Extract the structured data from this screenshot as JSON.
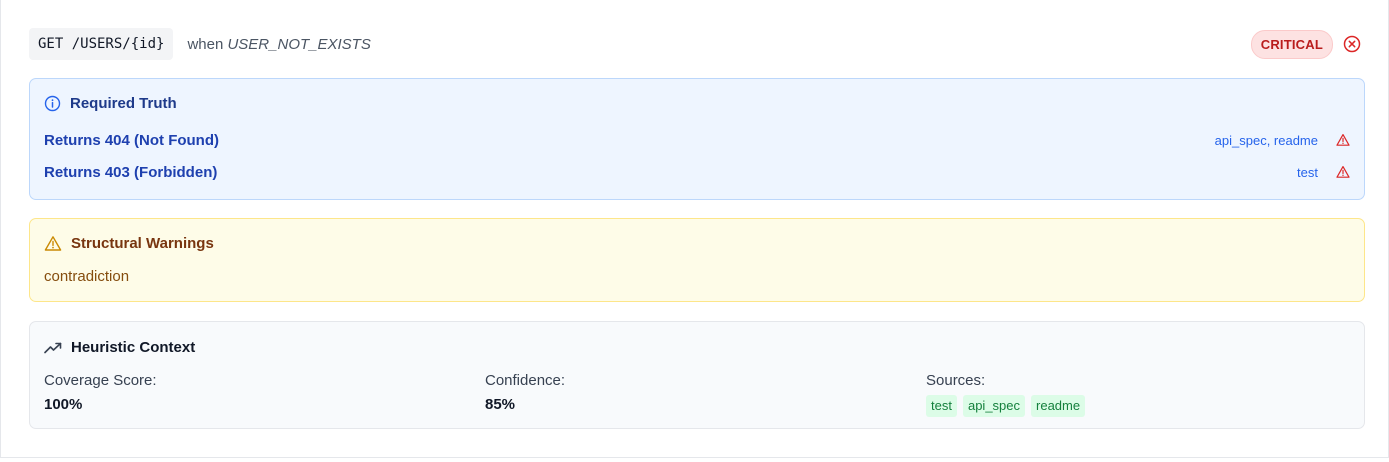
{
  "header": {
    "method_path": "GET /USERS/{id}",
    "when_label": "when",
    "condition": "USER_NOT_EXISTS",
    "severity": "CRITICAL",
    "severity_color": "#b91c1c"
  },
  "required_truth": {
    "title": "Required Truth",
    "icon": "info-icon",
    "items": [
      {
        "label": "Returns 404 (Not Found)",
        "sources": "api_spec, readme",
        "icon": "warning-icon"
      },
      {
        "label": "Returns 403 (Forbidden)",
        "sources": "test",
        "icon": "warning-icon"
      }
    ]
  },
  "structural_warnings": {
    "title": "Structural Warnings",
    "icon": "warning-triangle-icon",
    "items": [
      "contradiction"
    ]
  },
  "heuristic_context": {
    "title": "Heuristic Context",
    "icon": "trending-up-icon",
    "coverage_label": "Coverage Score:",
    "coverage_value": "100%",
    "confidence_label": "Confidence:",
    "confidence_value": "85%",
    "sources_label": "Sources:",
    "sources": [
      "test",
      "api_spec",
      "readme"
    ]
  }
}
